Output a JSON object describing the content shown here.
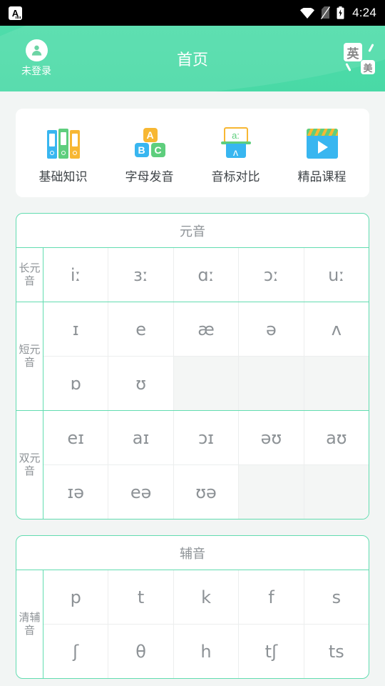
{
  "statusbar": {
    "app_icon": "letter-a-notification-icon",
    "wifi_icon": "wifi-icon",
    "sim_icon": "sim-off-icon",
    "battery_icon": "battery-charging-icon",
    "time": "4:24"
  },
  "appbar": {
    "title": "首页",
    "profile_label": "未登录",
    "avatar_icon": "person-avatar-icon",
    "lang_en": "英",
    "lang_us": "美",
    "accent": "#4fdcaa"
  },
  "quick_links": [
    {
      "label": "基础知识",
      "icon": "binders-icon"
    },
    {
      "label": "字母发音",
      "icon": "abc-blocks-icon",
      "blocks": [
        "A",
        "B",
        "C"
      ]
    },
    {
      "label": "音标对比",
      "icon": "phonetic-compare-icon",
      "top": "a:",
      "bottom": "ʌ"
    },
    {
      "label": "精品课程",
      "icon": "video-clapperboard-icon"
    }
  ],
  "sections": [
    {
      "title": "元音",
      "groups": [
        {
          "label": "长元音",
          "rows": [
            [
              "iː",
              "ɜː",
              "ɑː",
              "ɔː",
              "uː"
            ]
          ]
        },
        {
          "label": "短元音",
          "rows": [
            [
              "ɪ",
              "e",
              "æ",
              "ə",
              "ʌ"
            ],
            [
              "ɒ",
              "ʊ",
              "",
              "",
              ""
            ]
          ]
        },
        {
          "label": "双元音",
          "rows": [
            [
              "eɪ",
              "aɪ",
              "ɔɪ",
              "əʊ",
              "aʊ"
            ],
            [
              "ɪə",
              "eə",
              "ʊə",
              "",
              ""
            ]
          ]
        }
      ]
    },
    {
      "title": "辅音",
      "groups": [
        {
          "label": "清辅音",
          "rows": [
            [
              "p",
              "t",
              "k",
              "f",
              "s"
            ],
            [
              "ʃ",
              "θ",
              "h",
              "tʃ",
              "ts"
            ]
          ]
        }
      ]
    }
  ]
}
